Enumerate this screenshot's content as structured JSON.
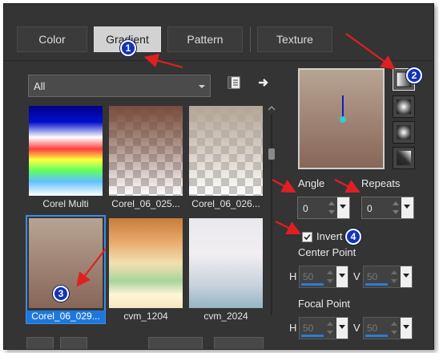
{
  "tabs": [
    {
      "label": "Color"
    },
    {
      "label": "Gradient"
    },
    {
      "label": "Pattern"
    },
    {
      "label": "Texture"
    }
  ],
  "category_select": {
    "value": "All"
  },
  "toolbar_icons": [
    "gradient-library-icon",
    "arrow-right-icon"
  ],
  "gradients": [
    {
      "name": "Corel Multi"
    },
    {
      "name": "Corel_06_025..."
    },
    {
      "name": "Corel_06_026..."
    },
    {
      "name": "Corel_06_029...",
      "selected": true
    },
    {
      "name": "cvm_1204"
    },
    {
      "name": "cvm_2024"
    }
  ],
  "style_icons": [
    "linear-style-icon",
    "rectangular-style-icon",
    "sunburst-style-icon",
    "radial-style-icon"
  ],
  "angle": {
    "label": "Angle",
    "value": "0"
  },
  "repeats": {
    "label": "Repeats",
    "value": "0"
  },
  "invert": {
    "label": "Invert",
    "checked": true
  },
  "center_point": {
    "label": "Center Point",
    "h_label": "H",
    "h_value": "50",
    "v_label": "V",
    "v_value": "50"
  },
  "focal_point": {
    "label": "Focal Point",
    "h_label": "H",
    "h_value": "50",
    "v_label": "V",
    "v_value": "50"
  },
  "markers": [
    "1",
    "2",
    "3",
    "4"
  ],
  "colors": {
    "accent": "#1e78dc",
    "annotation_arrow": "#e02020",
    "marker": "#1234b8",
    "panel": "#343434"
  }
}
